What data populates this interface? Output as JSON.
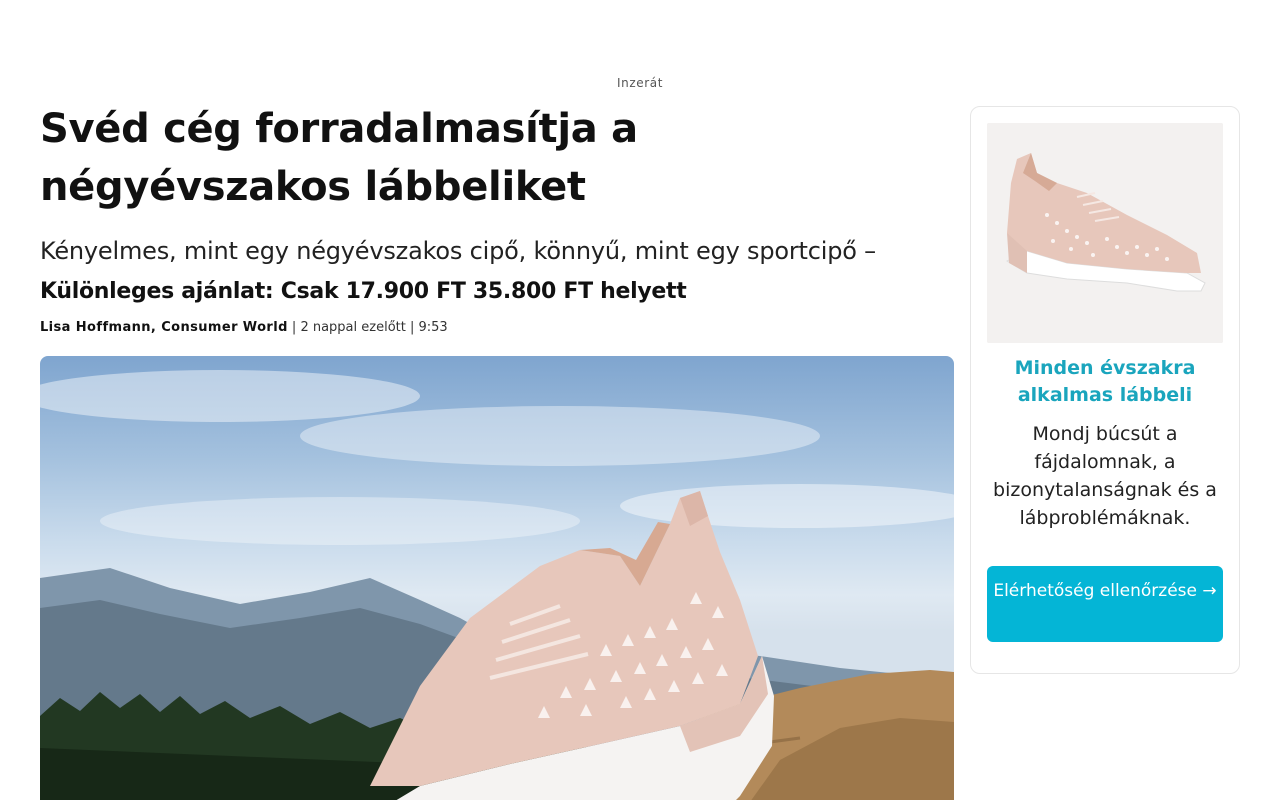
{
  "ad_label": "Inzerát",
  "article": {
    "headline": "Svéd cég forradalmasítja a négyévszakos lábbeliket",
    "subheadline": "Kényelmes, mint egy négyévszakos cipő, könnyű, mint egy sportcipő –",
    "offer": "Különleges ajánlat: Csak 17.900 FT 35.800 FT helyett",
    "byline": {
      "author": "Lisa Hoffmann, Consumer World",
      "meta": " | 2 nappal ezelőtt | 9:53"
    }
  },
  "sidebar": {
    "title": "Minden évszakra alkalmas lábbeli",
    "text": "Mondj búcsút a fájdalomnak, a bizonytalanságnak és a lábproblémáknak.",
    "cta_label": "Elérhetőség ellenőrzése →"
  },
  "colors": {
    "accent": "#1aa5bd",
    "button": "#04b5d6",
    "shoe": "#e7c7bb"
  }
}
